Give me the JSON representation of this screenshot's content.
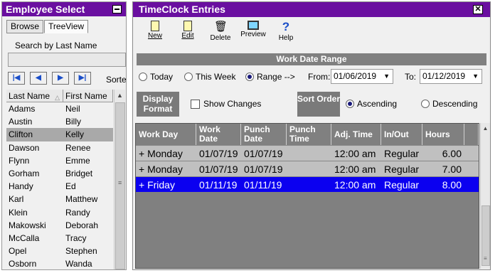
{
  "left_panel": {
    "title": "Employee Select",
    "tabs": [
      {
        "label": "Browse",
        "active": false
      },
      {
        "label": "TreeView",
        "active": true
      }
    ],
    "search_label": "Search by Last Name",
    "search_value": "",
    "sort_label": "Sorte",
    "columns": [
      "Last Name",
      "First Name"
    ],
    "employees": [
      {
        "last": "Adams",
        "first": "Neil"
      },
      {
        "last": "Austin",
        "first": "Billy"
      },
      {
        "last": "Clifton",
        "first": "Kelly",
        "selected": true
      },
      {
        "last": "Dawson",
        "first": "Renee"
      },
      {
        "last": "Flynn",
        "first": "Emme"
      },
      {
        "last": "Gorham",
        "first": "Bridget"
      },
      {
        "last": "Handy",
        "first": "Ed"
      },
      {
        "last": "Karl",
        "first": "Matthew"
      },
      {
        "last": "Klein",
        "first": "Randy"
      },
      {
        "last": "Makowski",
        "first": "Deborah"
      },
      {
        "last": "McCalla",
        "first": "Tracy"
      },
      {
        "last": "Opel",
        "first": "Stephen"
      },
      {
        "last": "Osborn",
        "first": "Wanda"
      }
    ]
  },
  "right_panel": {
    "title": "TimeClock Entries",
    "toolbar": [
      {
        "label": "New",
        "icon": "new-doc-icon"
      },
      {
        "label": "Edit",
        "icon": "edit-doc-icon"
      },
      {
        "label": "Delete",
        "icon": "trash-icon"
      },
      {
        "label": "Preview",
        "icon": "monitor-icon"
      },
      {
        "label": "Help",
        "icon": "help-icon"
      }
    ],
    "work_date_range_label": "Work Date Range",
    "range_options": [
      {
        "label": "Today",
        "selected": false
      },
      {
        "label": "This Week",
        "selected": false
      },
      {
        "label": "Range -->",
        "selected": true
      }
    ],
    "from_label": "From:",
    "from_value": "01/06/2019",
    "to_label": "To:",
    "to_value": "01/12/2019",
    "display_format_label": "Display Format",
    "show_changes_label": "Show Changes",
    "sort_order_label": "Sort Order",
    "sort_options": [
      {
        "label": "Ascending",
        "selected": true
      },
      {
        "label": "Descending",
        "selected": false
      }
    ],
    "grid_columns": [
      "Work Day",
      "Work Date",
      "Punch Date",
      "Punch Time",
      "Adj. Time",
      "In/Out",
      "Hours"
    ],
    "entries": [
      {
        "day": "+ Monday",
        "work_date": "01/07/19",
        "punch_date": "01/07/19",
        "punch_time": "",
        "adj_time": "12:00 am",
        "in_out": "Regular",
        "hours": "6.00",
        "style": "alt"
      },
      {
        "day": "+ Monday",
        "work_date": "01/07/19",
        "punch_date": "01/07/19",
        "punch_time": "",
        "adj_time": "12:00 am",
        "in_out": "Regular",
        "hours": "7.00",
        "style": "alt"
      },
      {
        "day": "+ Friday",
        "work_date": "01/11/19",
        "punch_date": "01/11/19",
        "punch_time": "",
        "adj_time": "12:00 am",
        "in_out": "Regular",
        "hours": "8.00",
        "style": "hl"
      }
    ]
  },
  "colors": {
    "title_bar": "#6a0fa0",
    "selection": "#0b00f0",
    "group_label": "#7a7a7a"
  }
}
